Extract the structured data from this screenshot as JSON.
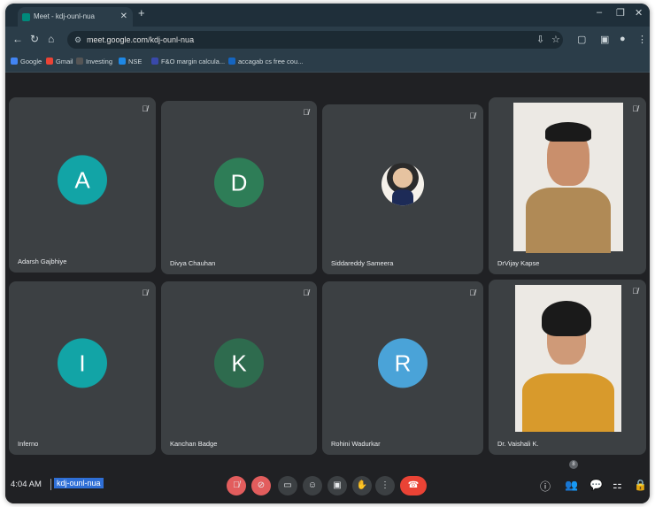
{
  "browser": {
    "tab_title": "Meet - kdj-ounl-nua",
    "tab_close": "✕",
    "new_tab": "+",
    "url": "meet.google.com/kdj-ounl-nua",
    "bookmarks": [
      {
        "label": "Google",
        "color": "#4285f4"
      },
      {
        "label": "Gmail",
        "color": "#ea4335"
      },
      {
        "label": "Investing",
        "color": "#555555"
      },
      {
        "label": "NSE",
        "color": "#1e88e5"
      },
      {
        "label": "F&O margin calcula...",
        "color": "#3949ab"
      },
      {
        "label": "accagab cs free cou...",
        "color": "#1565c0"
      }
    ]
  },
  "participants": [
    {
      "name": "Adarsh Gajbhiye",
      "initial": "A",
      "avatar_color": "#12a4a6"
    },
    {
      "name": "Divya Chauhan",
      "initial": "D",
      "avatar_color": "#2e7d57"
    },
    {
      "name": "Siddareddy Sameera",
      "initial": "",
      "avatar_color": ""
    },
    {
      "name": "DrVijay Kapse",
      "initial": "",
      "avatar_color": ""
    },
    {
      "name": "Inferno",
      "initial": "I",
      "avatar_color": "#12a4a6"
    },
    {
      "name": "Kanchan Badge",
      "initial": "K",
      "avatar_color": "#2e6b4e"
    },
    {
      "name": "Rohini Wadurkar",
      "initial": "R",
      "avatar_color": "#4aa3d8"
    },
    {
      "name": "Dr. Vaishali K.",
      "initial": "",
      "avatar_color": ""
    }
  ],
  "controls": {
    "time": "4:04 AM",
    "meeting_code": "kdj-ounl-nua",
    "participant_count": "8"
  },
  "icons": {
    "mic_off": "mic-off-icon",
    "cam_off": "camera-off-icon"
  }
}
